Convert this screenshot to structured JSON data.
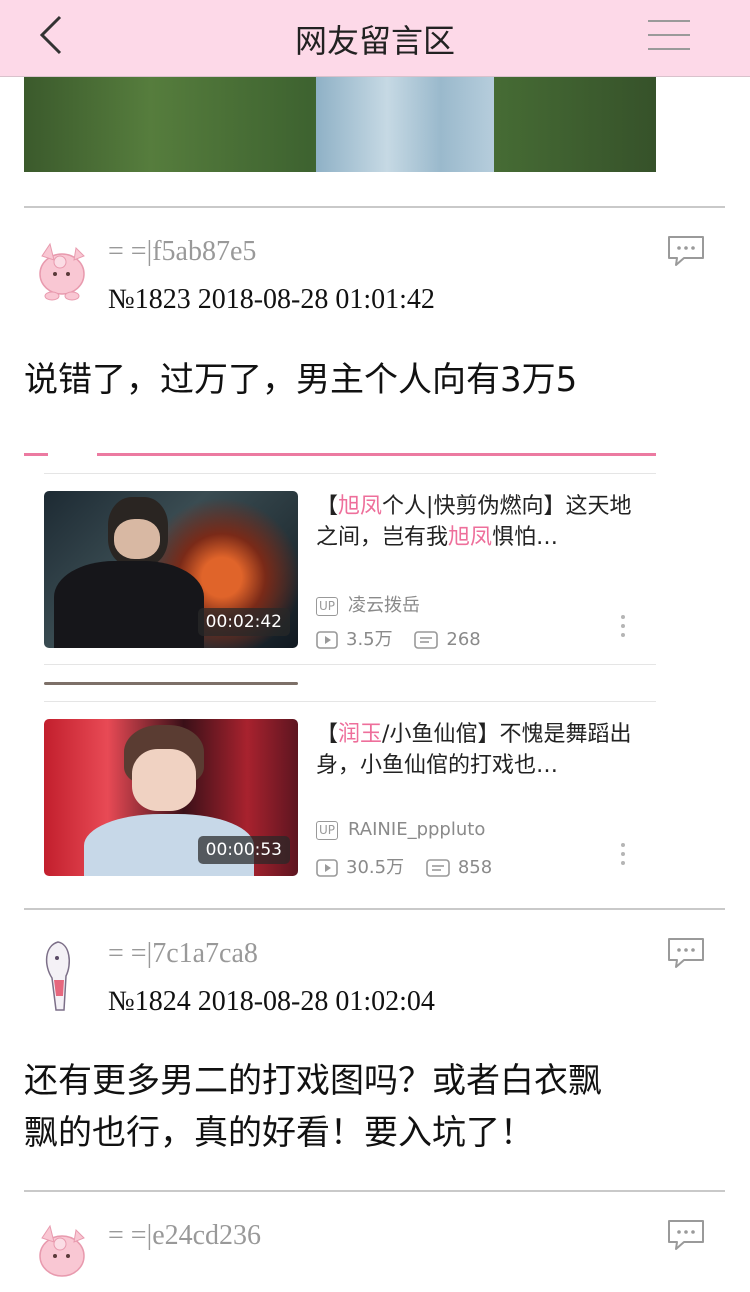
{
  "header": {
    "title": "网友留言区"
  },
  "icons": {
    "back": "chevron-left-icon",
    "menu": "hamburger-menu-icon",
    "reply": "comment-bubble-icon",
    "up": "up-tag-icon",
    "play": "play-icon",
    "danmaku": "danmaku-icon",
    "more": "more-vertical-icon"
  },
  "colors": {
    "header_bg": "#fdd9e8",
    "accent_pink": "#ee6f9b",
    "divider": "#c9c9c9"
  },
  "comments": [
    {
      "user": "= =|f5ab87e5",
      "meta": "№1823   2018-08-28 01:01:42",
      "text": "说错了，过万了，男主个人向有3万5"
    },
    {
      "user": "= =|7c1a7ca8",
      "meta": "№1824   2018-08-28 01:02:04",
      "text_line1": "还有更多男二的打戏图吗？或者白衣飘",
      "text_line2": "飘的也行，真的好看！要入坑了！"
    },
    {
      "user": "= =|e24cd236"
    }
  ],
  "videos": [
    {
      "title_p1": "【",
      "title_hl1": "旭凤",
      "title_p2": "个人|快剪伪燃向】这天地之间，岂有我",
      "title_hl2": "旭凤",
      "title_p3": "惧怕…",
      "duration": "00:02:42",
      "up_tag": "UP",
      "uploader": "凌云拨岳",
      "views": "3.5万",
      "danmaku": "268"
    },
    {
      "title_p1": "【",
      "title_hl1": "润玉",
      "title_p2": "/小鱼仙倌】不愧是舞蹈出身，小鱼仙倌的打戏也…",
      "duration": "00:00:53",
      "up_tag": "UP",
      "uploader": "RAINIE_pppluto",
      "views": "30.5万",
      "danmaku": "858"
    }
  ]
}
